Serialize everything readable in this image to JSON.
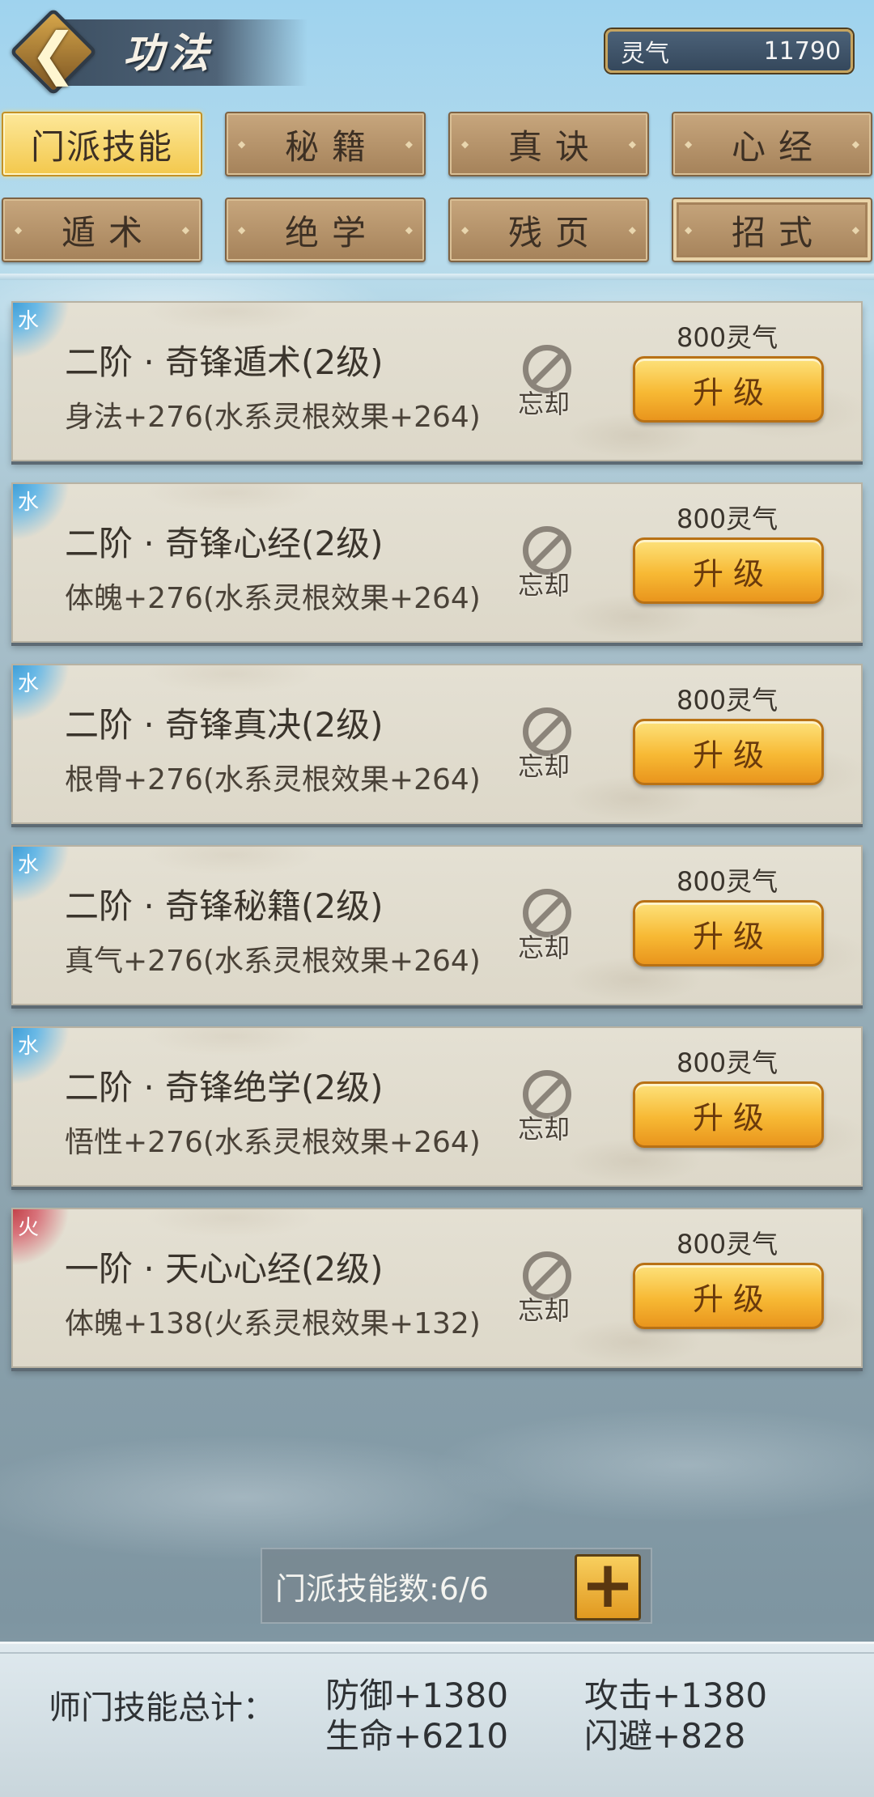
{
  "header": {
    "title": "功法",
    "currency_label": "灵气",
    "currency_value": "11790"
  },
  "tabs": [
    {
      "label": "门派技能",
      "active": true
    },
    {
      "label": "秘籍",
      "active": false
    },
    {
      "label": "真诀",
      "active": false
    },
    {
      "label": "心经",
      "active": false
    },
    {
      "label": "遁术",
      "active": false
    },
    {
      "label": "绝学",
      "active": false
    },
    {
      "label": "残页",
      "active": false
    },
    {
      "label": "招式",
      "active": false
    }
  ],
  "skills": [
    {
      "element": "水",
      "name": "二阶 · 奇锋遁术(2级)",
      "effect": "身法+276(水系灵根效果+264)",
      "forget_label": "忘却",
      "cost": "800灵气",
      "upgrade_label": "升级"
    },
    {
      "element": "水",
      "name": "二阶 · 奇锋心经(2级)",
      "effect": "体魄+276(水系灵根效果+264)",
      "forget_label": "忘却",
      "cost": "800灵气",
      "upgrade_label": "升级"
    },
    {
      "element": "水",
      "name": "二阶 · 奇锋真决(2级)",
      "effect": "根骨+276(水系灵根效果+264)",
      "forget_label": "忘却",
      "cost": "800灵气",
      "upgrade_label": "升级"
    },
    {
      "element": "水",
      "name": "二阶 · 奇锋秘籍(2级)",
      "effect": "真气+276(水系灵根效果+264)",
      "forget_label": "忘却",
      "cost": "800灵气",
      "upgrade_label": "升级"
    },
    {
      "element": "水",
      "name": "二阶 · 奇锋绝学(2级)",
      "effect": "悟性+276(水系灵根效果+264)",
      "forget_label": "忘却",
      "cost": "800灵气",
      "upgrade_label": "升级"
    },
    {
      "element": "火",
      "name": "一阶 · 天心心经(2级)",
      "effect": "体魄+138(火系灵根效果+132)",
      "forget_label": "忘却",
      "cost": "800灵气",
      "upgrade_label": "升级"
    }
  ],
  "skill_count": {
    "label": "门派技能数:6/6",
    "add_icon": "plus-icon"
  },
  "footer": {
    "label": "师门技能总计：",
    "stats": [
      "防御+1380",
      "攻击+1380",
      "生命+6210",
      "闪避+828"
    ]
  },
  "colors": {
    "water": "#3f9fd8",
    "fire": "#c2424a",
    "gold_button": "#f7b934"
  }
}
